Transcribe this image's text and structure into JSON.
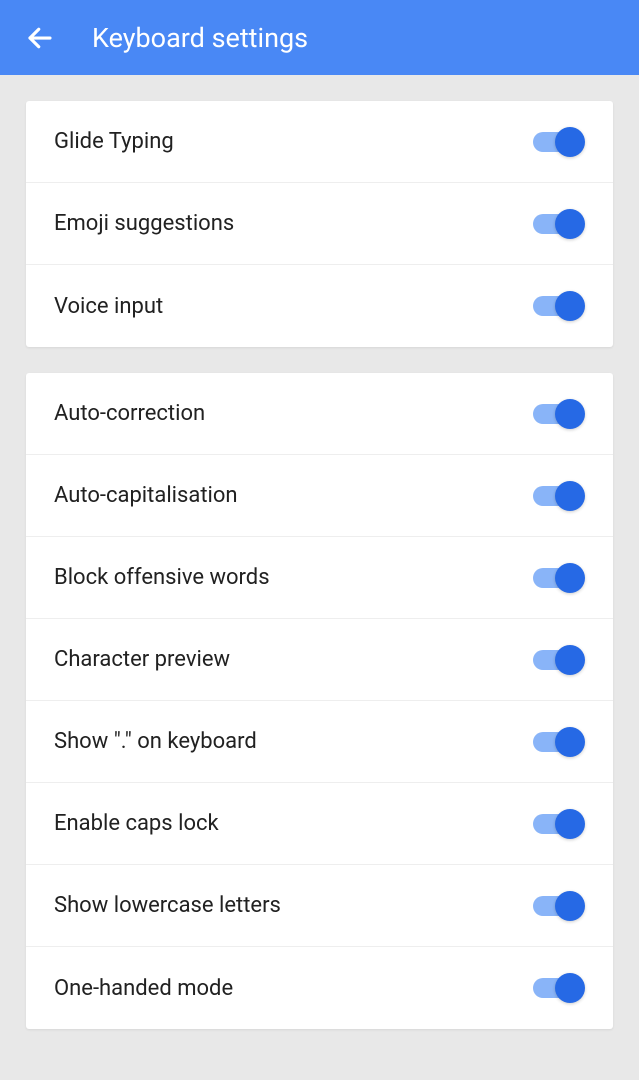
{
  "header": {
    "title": "Keyboard settings"
  },
  "sections": [
    {
      "items": [
        {
          "label": "Glide Typing",
          "on": true
        },
        {
          "label": "Emoji suggestions",
          "on": true
        },
        {
          "label": "Voice input",
          "on": true
        }
      ]
    },
    {
      "items": [
        {
          "label": "Auto-correction",
          "on": true
        },
        {
          "label": "Auto-capitalisation",
          "on": true
        },
        {
          "label": "Block offensive words",
          "on": true
        },
        {
          "label": "Character preview",
          "on": true
        },
        {
          "label": "Show \".\" on keyboard",
          "on": true
        },
        {
          "label": "Enable caps lock",
          "on": true
        },
        {
          "label": "Show lowercase letters",
          "on": true
        },
        {
          "label": "One-handed mode",
          "on": true
        }
      ]
    }
  ]
}
